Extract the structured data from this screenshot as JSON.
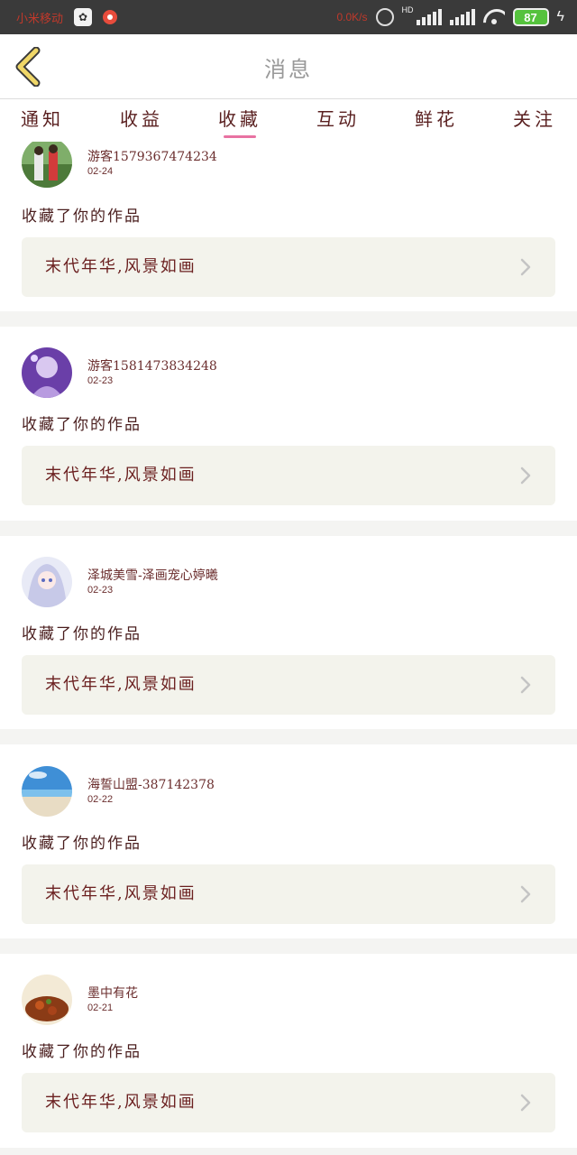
{
  "status_bar": {
    "carrier": "小米移动",
    "speed": "0.0K/s",
    "network": "HD",
    "battery": "87",
    "icons": [
      "paw-icon",
      "weibo-icon",
      "alarm-icon",
      "signal-icon",
      "wifi-icon",
      "battery-icon",
      "charging-icon"
    ]
  },
  "header": {
    "title": "消息",
    "back_icon": "chevron-left-icon"
  },
  "tabs": [
    {
      "label": "通知",
      "active": false
    },
    {
      "label": "收益",
      "active": false
    },
    {
      "label": "收藏",
      "active": true
    },
    {
      "label": "互动",
      "active": false
    },
    {
      "label": "鲜花",
      "active": false
    },
    {
      "label": "关注",
      "active": false
    }
  ],
  "items": [
    {
      "user": "游客1579367474234",
      "date": "02-24",
      "action": "收藏了你的作品",
      "work_title": "末代年华,风景如画"
    },
    {
      "user": "游客1581473834248",
      "date": "02-23",
      "action": "收藏了你的作品",
      "work_title": "末代年华,风景如画"
    },
    {
      "user": "泽城美雪-泽画宠心婷曦",
      "date": "02-23",
      "action": "收藏了你的作品",
      "work_title": "末代年华,风景如画"
    },
    {
      "user": "海誓山盟-387142378",
      "date": "02-22",
      "action": "收藏了你的作品",
      "work_title": "末代年华,风景如画"
    },
    {
      "user": "墨中有花",
      "date": "02-21",
      "action": "收藏了你的作品",
      "work_title": "末代年华,风景如画"
    }
  ],
  "colors": {
    "accent": "#e872a2",
    "text": "#6b2e2e",
    "work_bg": "#f3f3ec",
    "back_arrow": "#f0d768"
  }
}
